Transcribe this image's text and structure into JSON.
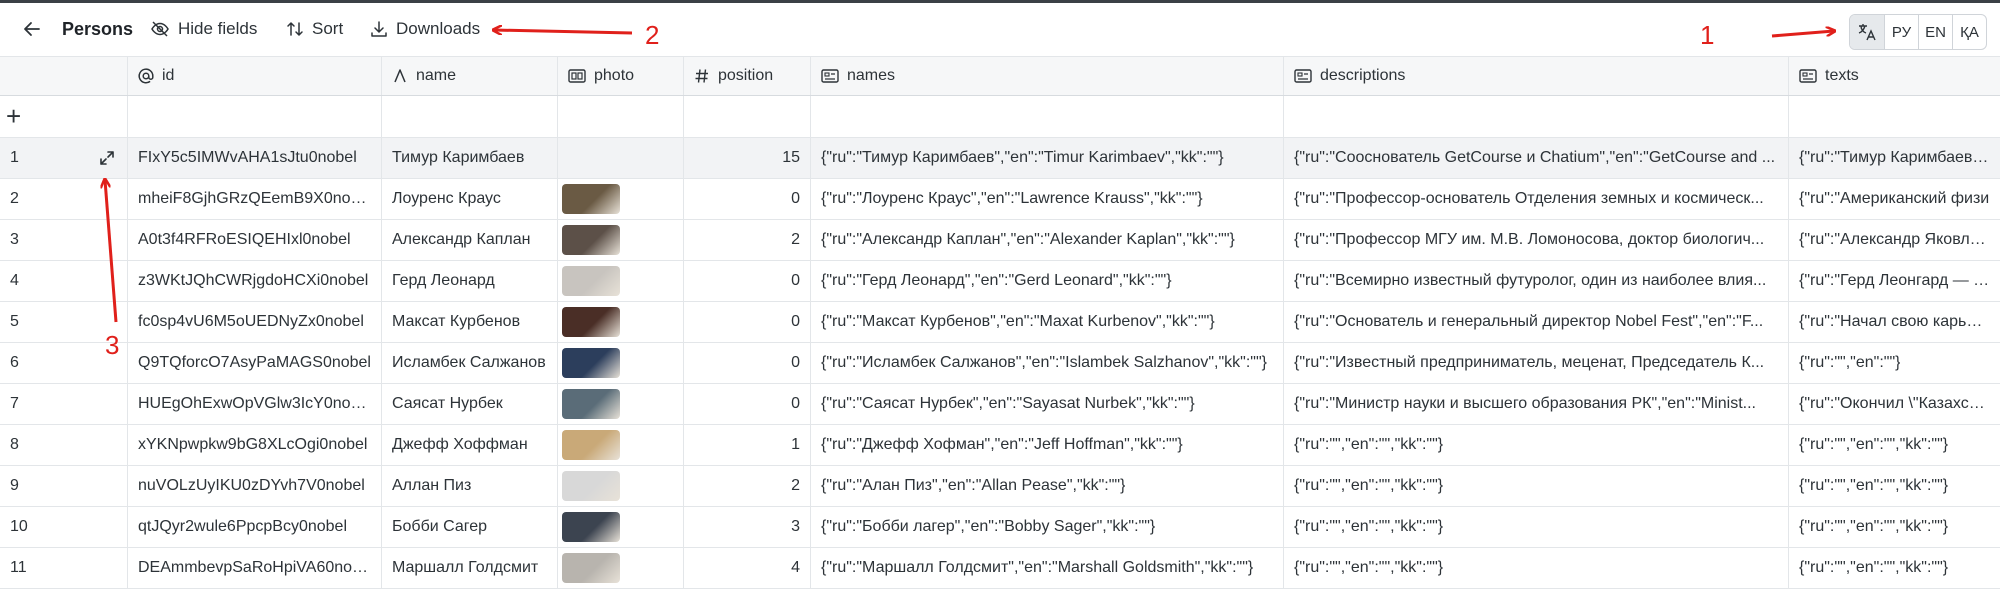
{
  "toolbar": {
    "title": "Persons",
    "hide_fields": "Hide fields",
    "sort": "Sort",
    "downloads": "Downloads"
  },
  "languages": [
    " ",
    "РУ",
    "EN",
    "ҚА"
  ],
  "columns": {
    "id": "id",
    "name": "name",
    "photo": "photo",
    "position": "position",
    "names": "names",
    "descriptions": "descriptions",
    "texts": "texts"
  },
  "add_symbol": "+",
  "rows": [
    {
      "n": "1",
      "id": "FIxY5c5IMWvAHA1sJtu0nobel",
      "name": "Тимур Каримбаев",
      "photo": "",
      "position": "15",
      "names": "{\"ru\":\"Тимур Каримбаев\",\"en\":\"Timur Karimbaev\",\"kk\":\"\"}",
      "descriptions": "{\"ru\":\"Сооснователь GetCourse и Chatium\",\"en\":\"GetCourse and ...",
      "texts": "{\"ru\":\"Тимур Каримбаев яв"
    },
    {
      "n": "2",
      "id": "mheiF8GjhGRzQEemB9X0nobel",
      "name": "Лоуренс Краус",
      "photo": "#6a5a44",
      "position": "0",
      "names": "{\"ru\":\"Лоуренс Краус\",\"en\":\"Lawrence Krauss\",\"kk\":\"\"}",
      "descriptions": "{\"ru\":\"Профессор-основатель Отделения земных и космическ...",
      "texts": "{\"ru\":\"Американский физи"
    },
    {
      "n": "3",
      "id": "A0t3f4RFRoESIQEHIxl0nobel",
      "name": "Александр Каплан",
      "photo": "#5c5048",
      "position": "2",
      "names": "{\"ru\":\"Александр Каплан\",\"en\":\"Alexander Kaplan\",\"kk\":\"\"}",
      "descriptions": "{\"ru\":\"Профессор МГУ им. М.В. Ломоносова, доктор биологич...",
      "texts": "{\"ru\":\"Александр Яковлеви"
    },
    {
      "n": "4",
      "id": "z3WKtJQhCWRjgdoHCXi0nobel",
      "name": "Герд Леонард",
      "photo": "#c8c4bf",
      "position": "0",
      "names": "{\"ru\":\"Герд Леонард\",\"en\":\"Gerd Leonard\",\"kk\":\"\"}",
      "descriptions": "{\"ru\":\"Всемирно известный футуролог, один из наиболее влия...",
      "texts": "{\"ru\":\"Герд Леонгард — ши"
    },
    {
      "n": "5",
      "id": "fc0sp4vU6M5oUEDNyZx0nobel",
      "name": "Максат Курбенов",
      "photo": "#4a2e26",
      "position": "0",
      "names": "{\"ru\":\"Максат Курбенов\",\"en\":\"Maxat Kurbenov\",\"kk\":\"\"}",
      "descriptions": "{\"ru\":\"Основатель и генеральный директор Nobel Fest\",\"en\":\"F...",
      "texts": "{\"ru\":\"Начал свою карьеру"
    },
    {
      "n": "6",
      "id": "Q9TQforcO7AsyPaMAGS0nobel",
      "name": "Исламбек Салжанов",
      "photo": "#2c3e5c",
      "position": "0",
      "names": "{\"ru\":\"Исламбек Салжанов\",\"en\":\"Islambek Salzhanov\",\"kk\":\"\"}",
      "descriptions": "{\"ru\":\"Известный предприниматель, меценат, Председатель К...",
      "texts": "{\"ru\":\"\",\"en\":\"\"}"
    },
    {
      "n": "7",
      "id": "HUEgOhExwOpVGlw3IcY0nobel",
      "name": "Саясат Нурбек",
      "photo": "#5a6c78",
      "position": "0",
      "names": "{\"ru\":\"Саясат Нурбек\",\"en\":\"Sayasat Nurbek\",\"kk\":\"\"}",
      "descriptions": "{\"ru\":\"Министр науки и высшего образования РК\",\"en\":\"Minist...",
      "texts": "{\"ru\":\"Окончил \\\"Казахско-"
    },
    {
      "n": "8",
      "id": "xYKNpwpkw9bG8XLcOgi0nobel",
      "name": "Джефф Хоффман",
      "photo": "#c9a978",
      "position": "1",
      "names": "{\"ru\":\"Джефф Хофман\",\"en\":\"Jeff Hoffman\",\"kk\":\"\"}",
      "descriptions": "{\"ru\":\"\",\"en\":\"\",\"kk\":\"\"}",
      "texts": "{\"ru\":\"\",\"en\":\"\",\"kk\":\"\"}"
    },
    {
      "n": "9",
      "id": "nuVOLzUyIKU0zDYvh7V0nobel",
      "name": "Аллан Пиз",
      "photo": "#d8d8d8",
      "position": "2",
      "names": "{\"ru\":\"Алан Пиз\",\"en\":\"Allan Pease\",\"kk\":\"\"}",
      "descriptions": "{\"ru\":\"\",\"en\":\"\",\"kk\":\"\"}",
      "texts": "{\"ru\":\"\",\"en\":\"\",\"kk\":\"\"}"
    },
    {
      "n": "10",
      "id": "qtJQyr2wule6PpcpBcy0nobel",
      "name": "Бобби Сагер",
      "photo": "#3c4450",
      "position": "3",
      "names": "{\"ru\":\"Бобби лагер\",\"en\":\"Bobby Sager\",\"kk\":\"\"}",
      "descriptions": "{\"ru\":\"\",\"en\":\"\",\"kk\":\"\"}",
      "texts": "{\"ru\":\"\",\"en\":\"\",\"kk\":\"\"}"
    },
    {
      "n": "11",
      "id": "DEAmmbevpSaRoHpiVA60nobel",
      "name": "Маршалл Голдсмит",
      "photo": "#b8b4ae",
      "position": "4",
      "names": "{\"ru\":\"Маршалл Голдсмит\",\"en\":\"Marshall Goldsmith\",\"kk\":\"\"}",
      "descriptions": "{\"ru\":\"\",\"en\":\"\",\"kk\":\"\"}",
      "texts": "{\"ru\":\"\",\"en\":\"\",\"kk\":\"\"}"
    }
  ],
  "annotations": {
    "one": "1",
    "two": "2",
    "three": "3",
    "color": "#e0201b"
  }
}
